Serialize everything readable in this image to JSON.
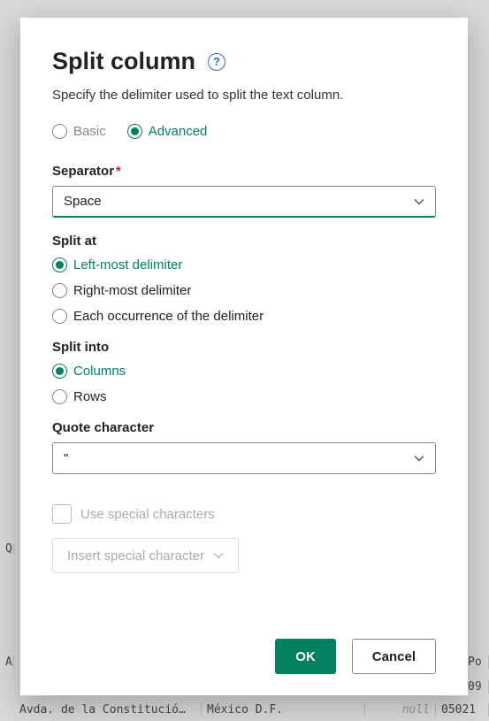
{
  "dialog": {
    "title": "Split column",
    "subtitle": "Specify the delimiter used to split the text column.",
    "mode": {
      "basic": "Basic",
      "advanced": "Advanced"
    },
    "separator": {
      "label": "Separator",
      "value": "Space"
    },
    "split_at": {
      "label": "Split at",
      "options": {
        "left": "Left-most delimiter",
        "right": "Right-most delimiter",
        "each": "Each occurrence of the delimiter"
      }
    },
    "split_into": {
      "label": "Split into",
      "options": {
        "columns": "Columns",
        "rows": "Rows"
      }
    },
    "quote": {
      "label": "Quote character",
      "value": "\""
    },
    "special": {
      "checkbox_label": "Use special characters",
      "insert_label": "Insert special character"
    },
    "buttons": {
      "ok": "OK",
      "cancel": "Cancel"
    }
  },
  "bg": {
    "q": "Q",
    "a": "A",
    "po": "Po",
    "n09": "09",
    "row3_addr": "Avda. de la Constitució…",
    "row3_city": "México D.F.",
    "row3_null": "null",
    "row3_zip": "05021"
  }
}
